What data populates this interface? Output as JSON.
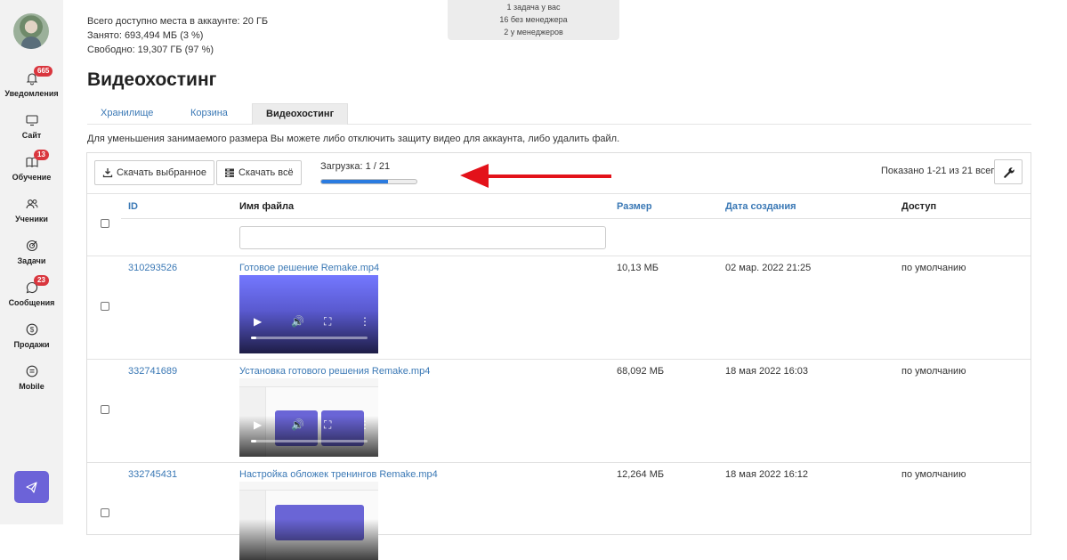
{
  "sidebar": {
    "items": [
      {
        "label": "Уведомления",
        "icon": "bell-icon",
        "badge": "665"
      },
      {
        "label": "Сайт",
        "icon": "monitor-icon",
        "badge": ""
      },
      {
        "label": "Обучение",
        "icon": "book-icon",
        "badge": "13"
      },
      {
        "label": "Ученики",
        "icon": "users-icon",
        "badge": ""
      },
      {
        "label": "Задачи",
        "icon": "target-icon",
        "badge": ""
      },
      {
        "label": "Сообщения",
        "icon": "chat-icon",
        "badge": "23"
      },
      {
        "label": "Продажи",
        "icon": "dollar-icon",
        "badge": ""
      },
      {
        "label": "Mobile",
        "icon": "mobile-icon",
        "badge": ""
      }
    ],
    "telegram_icon": "send-icon"
  },
  "storage": {
    "total": "Всего доступно места в аккаунте: 20 ГБ",
    "used": "Занято: 693,494 МБ (3 %)",
    "free": "Свободно: 19,307 ГБ (97 %)"
  },
  "tasks": {
    "line1": "1 задача у вас",
    "line2": "16 без менеджера",
    "line3": "2 у менеджеров"
  },
  "page_title": "Видеохостинг",
  "tabs": [
    {
      "label": "Хранилище",
      "active": false
    },
    {
      "label": "Корзина",
      "active": false
    },
    {
      "label": "Видеохостинг",
      "active": true
    }
  ],
  "hint": "Для уменьшения занимаемого размера Вы можете либо отключить защиту видео для аккаунта, либо удалить файл.",
  "toolbar": {
    "download_selected": "Скачать выбранное",
    "download_all": "Скачать всё",
    "upload_label": "Загрузка: 1 / 21",
    "upload_progress": 0.7,
    "shown": "Показано 1-21 из 21 всего."
  },
  "table": {
    "headers": {
      "id": "ID",
      "name": "Имя файла",
      "size": "Размер",
      "date": "Дата создания",
      "access": "Доступ"
    },
    "rows": [
      {
        "id": "310293526",
        "name": "Готовое решение Remake.mp4",
        "size": "10,13 МБ",
        "date": "02 мар. 2022 21:25",
        "access": "по умолчанию"
      },
      {
        "id": "332741689",
        "name": "Установка готового решения Remake.mp4",
        "size": "68,092 МБ",
        "date": "18 мая 2022 16:03",
        "access": "по умолчанию"
      },
      {
        "id": "332745431",
        "name": "Настройка обложек тренингов Remake.mp4",
        "size": "12,264 МБ",
        "date": "18 мая 2022 16:12",
        "access": "по умолчанию"
      }
    ]
  },
  "colors": {
    "link": "#3a78b5",
    "progress": "#2a7be0",
    "badge": "#d9363e",
    "arrow": "#e3121a",
    "telegram": "#6c63d8"
  }
}
